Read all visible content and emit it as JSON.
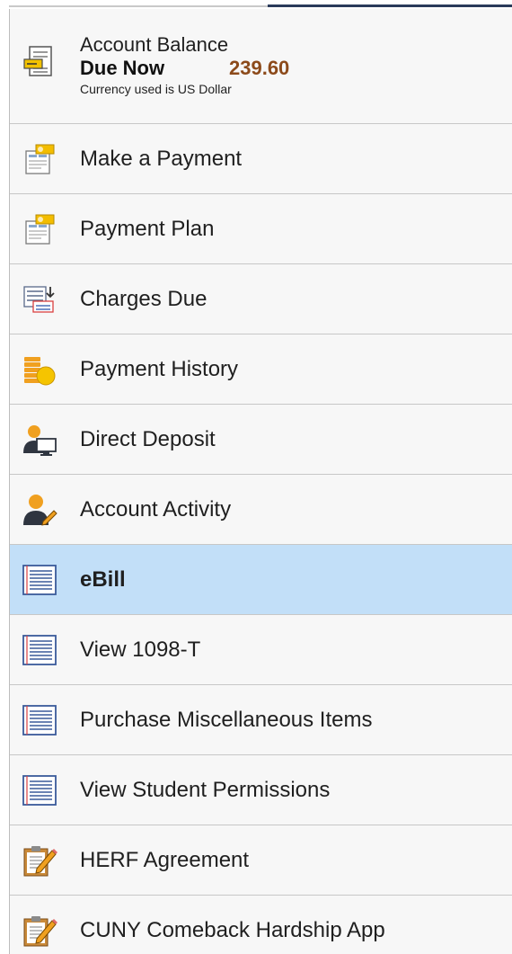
{
  "account_balance": {
    "title": "Account Balance",
    "due_label": "Due Now",
    "amount": "239.60",
    "currency_note": "Currency used is US Dollar",
    "icon": "bill-icon"
  },
  "menu": [
    {
      "label": "Make a Payment",
      "icon": "payment-form-icon",
      "selected": false
    },
    {
      "label": "Payment Plan",
      "icon": "payment-form-icon",
      "selected": false
    },
    {
      "label": "Charges Due",
      "icon": "charges-list-icon",
      "selected": false
    },
    {
      "label": "Payment History",
      "icon": "coins-icon",
      "selected": false
    },
    {
      "label": "Direct Deposit",
      "icon": "person-monitor-icon",
      "selected": false
    },
    {
      "label": "Account Activity",
      "icon": "person-pencil-icon",
      "selected": false
    },
    {
      "label": "eBill",
      "icon": "document-lines-icon",
      "selected": true
    },
    {
      "label": "View 1098-T",
      "icon": "document-lines-icon",
      "selected": false
    },
    {
      "label": "Purchase Miscellaneous Items",
      "icon": "document-lines-icon",
      "selected": false
    },
    {
      "label": "View Student Permissions",
      "icon": "document-lines-icon",
      "selected": false
    },
    {
      "label": "HERF Agreement",
      "icon": "clipboard-pencil-icon",
      "selected": false
    },
    {
      "label": "CUNY Comeback Hardship App",
      "icon": "clipboard-pencil-icon",
      "selected": false
    }
  ],
  "colors": {
    "selected_bg": "#c2dff8",
    "amount": "#8c4a1a",
    "panel_bg": "#f7f7f7"
  }
}
